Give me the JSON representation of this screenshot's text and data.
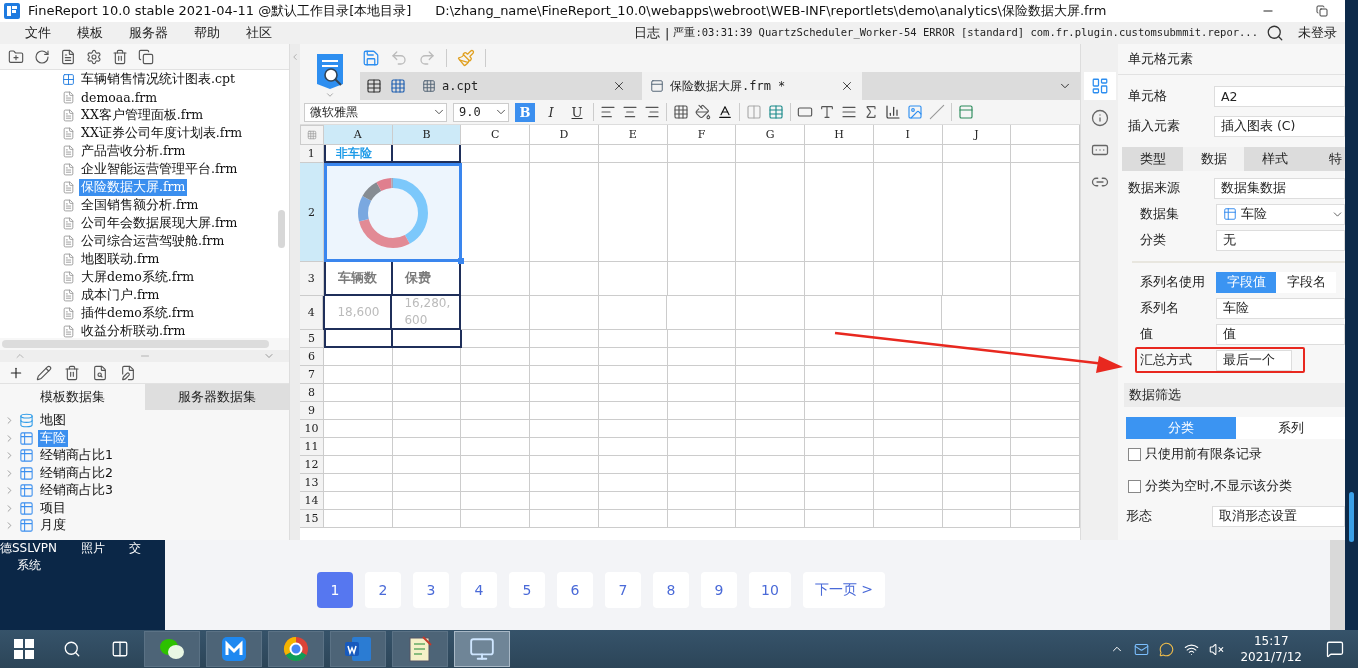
{
  "title_bar": {
    "title": "FineReport 10.0 stable 2021-04-11 @默认工作目录[本地目录]",
    "path": "D:\\zhang_name\\FineReport_10.0\\webapps\\webroot\\WEB-INF\\reportlets\\demo\\analytics\\保险数据大屏.frm"
  },
  "menu_bar": {
    "items": [
      "文件",
      "模板",
      "服务器",
      "帮助",
      "社区"
    ],
    "log_label": "日志",
    "separator": "|",
    "log_message": "严重:03:31:39 QuartzScheduler_Worker-54 ERROR [standard] com.fr.plugin.customsubmmit.repor...",
    "login": "未登录"
  },
  "file_tree": {
    "items": [
      {
        "label": "车辆销售情况统计图表.cpt",
        "kind": "cpt",
        "selected": false
      },
      {
        "label": "demoaa.frm",
        "kind": "frm",
        "selected": false
      },
      {
        "label": "XX客户管理面板.frm",
        "kind": "frm",
        "selected": false
      },
      {
        "label": "XX证券公司年度计划表.frm",
        "kind": "frm",
        "selected": false
      },
      {
        "label": "产品营收分析.frm",
        "kind": "frm",
        "selected": false
      },
      {
        "label": "企业智能运营管理平台.frm",
        "kind": "frm",
        "selected": false
      },
      {
        "label": "保险数据大屏.frm",
        "kind": "frm",
        "selected": true
      },
      {
        "label": "全国销售额分析.frm",
        "kind": "frm",
        "selected": false
      },
      {
        "label": "公司年会数据展现大屏.frm",
        "kind": "frm",
        "selected": false
      },
      {
        "label": "公司综合运营驾驶舱.frm",
        "kind": "frm",
        "selected": false
      },
      {
        "label": "地图联动.frm",
        "kind": "frm",
        "selected": false
      },
      {
        "label": "大屏demo系统.frm",
        "kind": "frm",
        "selected": false
      },
      {
        "label": "成本门户.frm",
        "kind": "frm",
        "selected": false
      },
      {
        "label": "插件demo系统.frm",
        "kind": "frm",
        "selected": false
      },
      {
        "label": "收益分析联动.frm",
        "kind": "frm",
        "selected": false
      }
    ]
  },
  "dataset_panel": {
    "tabs": [
      {
        "label": "模板数据集",
        "selected": true
      },
      {
        "label": "服务器数据集",
        "selected": false
      }
    ],
    "items": [
      {
        "label": "地图",
        "kind": "database",
        "selected": false
      },
      {
        "label": "车险",
        "kind": "table",
        "selected": true
      },
      {
        "label": "经销商占比1",
        "kind": "table",
        "selected": false
      },
      {
        "label": "经销商占比2",
        "kind": "table",
        "selected": false
      },
      {
        "label": "经销商占比3",
        "kind": "table",
        "selected": false
      },
      {
        "label": "项目",
        "kind": "table",
        "selected": false
      },
      {
        "label": "月度",
        "kind": "table",
        "selected": false
      }
    ]
  },
  "editor": {
    "tabs": [
      {
        "label": "a.cpt",
        "selected": false
      },
      {
        "label": "保险数据大屏.frm *",
        "selected": true
      }
    ],
    "font": "微软雅黑",
    "font_size": "9.0",
    "styles": [
      {
        "label": "B",
        "kind": "bold",
        "selected": true
      },
      {
        "label": "I",
        "kind": "italic",
        "selected": false
      },
      {
        "label": "U",
        "kind": "underline",
        "selected": false
      }
    ]
  },
  "sheet": {
    "columns": [
      {
        "label": "A",
        "selected": true
      },
      {
        "label": "B",
        "selected": true
      },
      {
        "label": "C",
        "selected": false
      },
      {
        "label": "D",
        "selected": false
      },
      {
        "label": "E",
        "selected": false
      },
      {
        "label": "F",
        "selected": false
      },
      {
        "label": "G",
        "selected": false
      },
      {
        "label": "H",
        "selected": false
      },
      {
        "label": "I",
        "selected": false
      },
      {
        "label": "J",
        "selected": false
      }
    ],
    "rows": [
      {
        "number": "1",
        "kind": "title",
        "selected": false,
        "framed": true,
        "cells": [
          "非车险"
        ]
      },
      {
        "number": "2",
        "kind": "chart",
        "selected": true,
        "framed": true
      },
      {
        "number": "3",
        "kind": "header",
        "selected": false,
        "framed": true,
        "cells": [
          "车辆数",
          "保费"
        ]
      },
      {
        "number": "4",
        "kind": "value",
        "selected": false,
        "framed": true,
        "cells": [
          "18,600",
          "16,280,600"
        ]
      },
      {
        "number": "5",
        "kind": "blank",
        "selected": false,
        "framed": true
      },
      {
        "number": "6",
        "kind": "blank",
        "selected": false,
        "framed": false
      },
      {
        "number": "7",
        "kind": "blank",
        "selected": false,
        "framed": false
      },
      {
        "number": "8",
        "kind": "blank",
        "selected": false,
        "framed": false
      },
      {
        "number": "9",
        "kind": "blank",
        "selected": false,
        "framed": false
      },
      {
        "number": "10",
        "kind": "blank",
        "selected": false,
        "framed": false
      },
      {
        "number": "11",
        "kind": "blank",
        "selected": false,
        "framed": false
      },
      {
        "number": "12",
        "kind": "blank",
        "selected": false,
        "framed": false
      },
      {
        "number": "13",
        "kind": "blank",
        "selected": false,
        "framed": false
      },
      {
        "number": "14",
        "kind": "blank",
        "selected": false,
        "framed": false
      },
      {
        "number": "15",
        "kind": "blank",
        "selected": false,
        "framed": false
      }
    ]
  },
  "side_strip": {
    "items": [
      {
        "kind": "cell",
        "selected": true
      },
      {
        "kind": "attributes",
        "selected": false
      },
      {
        "kind": "widget",
        "selected": false
      },
      {
        "kind": "link",
        "selected": false
      }
    ]
  },
  "properties": {
    "header": "单元格元素",
    "cell": {
      "label": "单元格",
      "value": "A2"
    },
    "insert": {
      "label": "插入元素",
      "value": "插入图表 (C)"
    },
    "tabs": [
      {
        "label": "类型",
        "selected": false
      },
      {
        "label": "数据",
        "selected": true
      },
      {
        "label": "样式",
        "selected": false
      },
      {
        "label": "特",
        "selected": false
      }
    ],
    "source": [
      {
        "kind": "field",
        "label": "数据来源",
        "value": "数据集数据"
      },
      {
        "kind": "select",
        "label": "数据集",
        "value": "车险"
      },
      {
        "kind": "field",
        "label": "分类",
        "value": "无"
      }
    ],
    "series": [
      {
        "kind": "segmented",
        "label": "系列名使用",
        "highlighted": false,
        "options": [
          {
            "label": "字段值",
            "selected": true
          },
          {
            "label": "字段名",
            "selected": false
          }
        ]
      },
      {
        "kind": "field",
        "label": "系列名",
        "value": "车险",
        "highlighted": false
      },
      {
        "kind": "field",
        "label": "值",
        "value": "值",
        "highlighted": false
      },
      {
        "kind": "field",
        "label": "汇总方式",
        "value": "最后一个",
        "highlighted": true
      }
    ],
    "filter": {
      "title": "数据筛选",
      "tabs": [
        {
          "label": "分类",
          "selected": true
        },
        {
          "label": "系列",
          "selected": false
        }
      ],
      "options": [
        {
          "label": "只使用前有限条记录",
          "checked": false
        },
        {
          "label": "分类为空时,不显示该分类",
          "checked": false
        }
      ]
    },
    "shape": {
      "label": "形态",
      "value": "取消形态设置"
    }
  },
  "desktop": {
    "icons": [
      {
        "lines": [
          "德SSLVPN",
          "系统"
        ]
      },
      {
        "lines": [
          "照片"
        ]
      },
      {
        "lines": [
          "交"
        ]
      }
    ]
  },
  "web_page": {
    "pages": [
      {
        "label": "1",
        "selected": true
      },
      {
        "label": "2",
        "selected": false
      },
      {
        "label": "3",
        "selected": false
      },
      {
        "label": "4",
        "selected": false
      },
      {
        "label": "5",
        "selected": false
      },
      {
        "label": "6",
        "selected": false
      },
      {
        "label": "7",
        "selected": false
      },
      {
        "label": "8",
        "selected": false
      },
      {
        "label": "9",
        "selected": false
      },
      {
        "label": "10",
        "selected": false
      }
    ],
    "next": "下一页 >"
  },
  "taskbar": {
    "apps": [
      {
        "kind": "chat",
        "selected": false
      },
      {
        "kind": "mail",
        "selected": false
      },
      {
        "kind": "browser",
        "selected": false
      },
      {
        "kind": "document",
        "selected": false
      },
      {
        "kind": "notepad",
        "selected": false
      },
      {
        "kind": "remote",
        "selected": true
      }
    ],
    "time": "15:17",
    "date": "2021/7/12"
  }
}
